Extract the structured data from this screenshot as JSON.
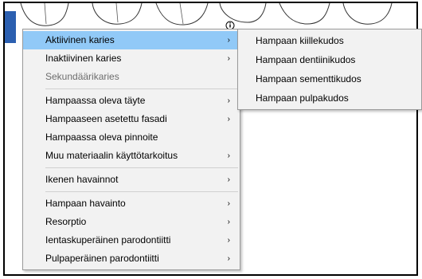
{
  "main_menu": {
    "groups": [
      [
        {
          "label": "Aktiivinen karies",
          "has_submenu": true,
          "state": "highlighted"
        },
        {
          "label": "Inaktiivinen karies",
          "has_submenu": true,
          "state": "normal"
        },
        {
          "label": "Sekundäärikaries",
          "has_submenu": false,
          "state": "disabled"
        }
      ],
      [
        {
          "label": "Hampaassa oleva täyte",
          "has_submenu": true,
          "state": "normal"
        },
        {
          "label": "Hampaaseen asetettu fasadi",
          "has_submenu": true,
          "state": "normal"
        },
        {
          "label": "Hampaassa oleva pinnoite",
          "has_submenu": false,
          "state": "normal"
        },
        {
          "label": "Muu materiaalin käyttötarkoitus",
          "has_submenu": true,
          "state": "normal"
        }
      ],
      [
        {
          "label": "Ikenen havainnot",
          "has_submenu": true,
          "state": "normal"
        }
      ],
      [
        {
          "label": "Hampaan havainto",
          "has_submenu": true,
          "state": "normal"
        },
        {
          "label": "Resorptio",
          "has_submenu": true,
          "state": "normal"
        },
        {
          "label": "Ientaskuperäinen parodontiitti",
          "has_submenu": true,
          "state": "normal"
        },
        {
          "label": "Pulpaperäinen parodontiitti",
          "has_submenu": true,
          "state": "normal"
        }
      ]
    ],
    "submenu_arrow": "›",
    "highlight_color": "#91c9f7"
  },
  "sub_menu": {
    "items": [
      {
        "label": "Hampaan kiillekudos"
      },
      {
        "label": "Hampaan dentiinikudos"
      },
      {
        "label": "Hampaan sementtikudos"
      },
      {
        "label": "Hampaan pulpakudos"
      }
    ]
  },
  "chart": {
    "tab_color": "#2b5fb0",
    "info_icon": "info-icon"
  }
}
